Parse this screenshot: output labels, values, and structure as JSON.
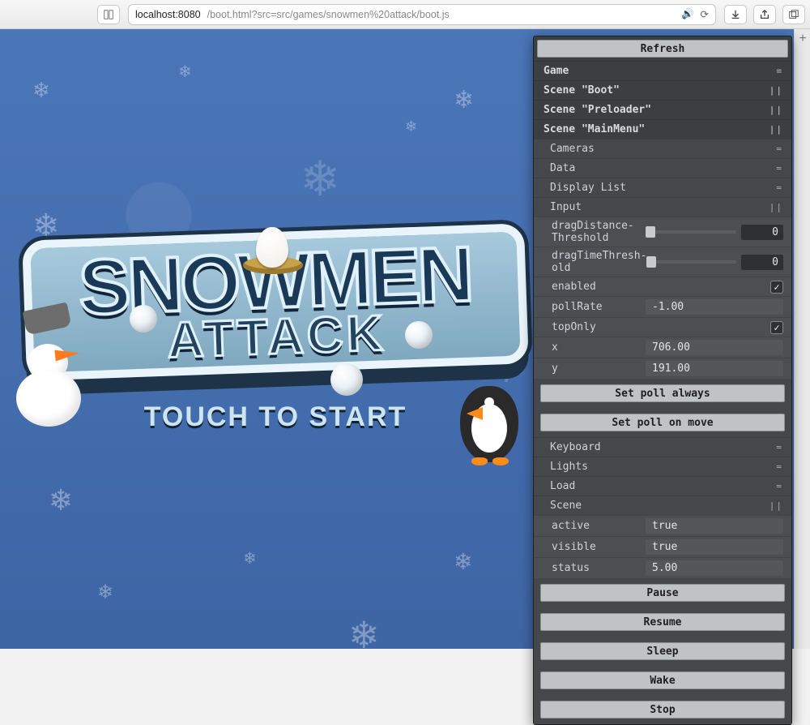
{
  "browser": {
    "url_host": "localhost:8080",
    "url_path": "/boot.html?src=src/games/snowmen%20attack/boot.js",
    "reader_icon": "reader-icon",
    "audio_icon": "audio-icon",
    "reload_icon": "reload-icon",
    "download_icon": "download-icon",
    "share_icon": "share-icon",
    "tabs_icon": "tabs-icon",
    "newtab": "+"
  },
  "game": {
    "title1": "SNOWMEN",
    "title2": "ATTACK",
    "touch": "TOUCH TO START"
  },
  "panel": {
    "refresh": "Refresh",
    "sections": {
      "game": "Game",
      "boot": "Scene \"Boot\"",
      "preloader": "Scene \"Preloader\"",
      "mainmenu": "Scene \"MainMenu\""
    },
    "sub": {
      "cameras": "Cameras",
      "data": "Data",
      "displaylist": "Display List",
      "input": "Input",
      "keyboard": "Keyboard",
      "lights": "Lights",
      "load": "Load",
      "scene": "Scene"
    },
    "input": {
      "dragDistanceLabel": "dragDistance-Threshold",
      "dragDistance": "0",
      "dragTimeLabel": "dragTimeThresh-old",
      "dragTime": "0",
      "enabledLabel": "enabled",
      "enabled": true,
      "pollRateLabel": "pollRate",
      "pollRate": "-1.00",
      "topOnlyLabel": "topOnly",
      "topOnly": true,
      "xLabel": "x",
      "x": "706.00",
      "yLabel": "y",
      "y": "191.00",
      "btn_poll_always": "Set poll always",
      "btn_poll_move": "Set poll on move"
    },
    "scene": {
      "activeLabel": "active",
      "active": "true",
      "visibleLabel": "visible",
      "visible": "true",
      "statusLabel": "status",
      "status": "5.00",
      "pause": "Pause",
      "resume": "Resume",
      "sleep": "Sleep",
      "wake": "Wake",
      "stop": "Stop"
    },
    "handle_h": "=",
    "handle_v": "||"
  }
}
